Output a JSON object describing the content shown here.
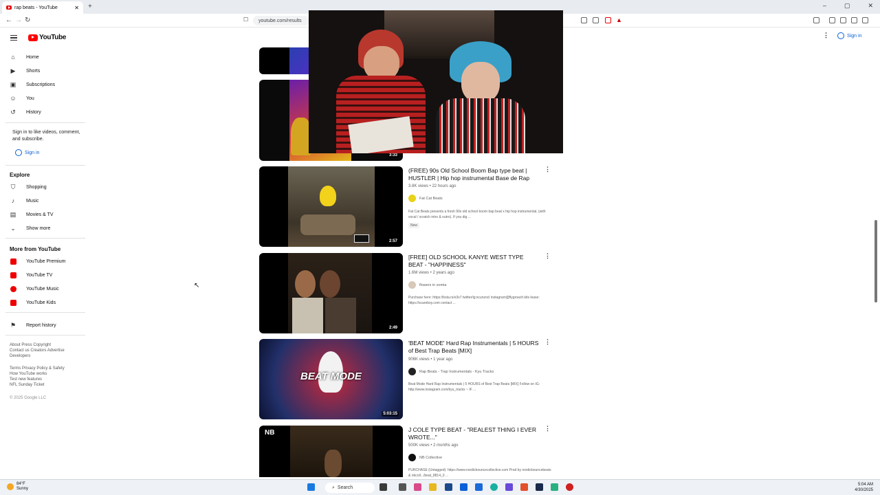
{
  "browser": {
    "tab_title": "rap beats - YouTube",
    "tab_close": "✕",
    "new_tab": "+",
    "address": "youtube.com/results",
    "win_min": "–",
    "win_max": "▢",
    "win_close": "✕"
  },
  "sidebar": {
    "logo_text": "YouTube",
    "main_items": [
      {
        "label": "Home",
        "icon": "home-icon"
      },
      {
        "label": "Shorts",
        "icon": "shorts-icon"
      },
      {
        "label": "Subscriptions",
        "icon": "subscriptions-icon"
      },
      {
        "label": "You",
        "icon": "you-icon"
      },
      {
        "label": "History",
        "icon": "history-icon"
      }
    ],
    "signin_note": "Sign in to like videos, comment, and subscribe.",
    "signin_label": "Sign in",
    "explore_title": "Explore",
    "explore_items": [
      {
        "label": "Shopping",
        "icon": "shopping-icon"
      },
      {
        "label": "Music",
        "icon": "music-icon"
      },
      {
        "label": "Movies & TV",
        "icon": "movies-icon"
      },
      {
        "label": "Show more",
        "icon": "chevron-down-icon"
      }
    ],
    "more_title": "More from YouTube",
    "more_items": [
      {
        "label": "YouTube Premium"
      },
      {
        "label": "YouTube TV"
      },
      {
        "label": "YouTube Music"
      },
      {
        "label": "YouTube Kids"
      }
    ],
    "report_history": "Report history",
    "footer1": "About  Press  Copyright\nContact us  Creators  Advertise\nDevelopers",
    "footer2": "Terms  Privacy  Policy & Safety\nHow YouTube works\nTest new features\nNFL Sunday Ticket",
    "copyright": "© 2025 Google LLC"
  },
  "header": {
    "signin_label": "Sign in"
  },
  "videos": [
    {
      "title": "",
      "duration": ""
    },
    {
      "title": "",
      "duration": "3:33"
    },
    {
      "title": "(FREE) 90s Old School Boom Bap type beat | HUSTLER | Hip hop instrumental Base de Rap",
      "meta": "3.8K views • 22 hours ago",
      "channel": "Fat Cat Beats",
      "desc": "Fat Cat Beats presents a fresh 90s old school boom bap beat x hip hop instrumental, (with vocal / scratch intro & outro). If you dig ...",
      "badge": "New",
      "duration": "2:57"
    },
    {
      "title": "[FREE] OLD SCHOOL KANYE WEST TYPE BEAT - \"HAPPINESS\"",
      "meta": "1.6M views • 2 years ago",
      "channel": "flowers in somia",
      "desc": "Purchase here: https://bsta.rs/e3x7 twitter/ig:scunzocl instagram@flygroach.kits lease: https://scareboy.com contact ...",
      "duration": "2:49"
    },
    {
      "title": "'BEAT MODE' Hard Rap Instrumentals | 5 HOURS of Best Trap Beats [MIX]",
      "meta": "906K views • 1 year ago",
      "channel": "Rap Beats - Trap Instrumentals - Kyu Tracks",
      "desc": "Beat Mode Hard Rap Instrumentals | 5 HOURS of Best Trap Beats [MIX] Follow on IG: http://www.instagram.com/kyu_tracks ~ IF ...",
      "duration": "5:03:15",
      "thumb_text": "BEAT MODE"
    },
    {
      "title": "J COLE TYPE BEAT - \"REALEST THING I EVER WROTE...\"",
      "meta": "500K views • 2 months ago",
      "channel": "NB Collective",
      "desc": "PURCHASE (Untagged): https://www.nordicbouncecollective.com Prod by nordicbouncebeats & nbcoll.../beat_8814_0 ...",
      "thumb_text": "NB"
    }
  ],
  "taskbar": {
    "weather_temp": "84°F",
    "weather_desc": "Sunny",
    "search": "Search",
    "time": "5:04 AM",
    "date": "4/30/2025"
  },
  "colors": {
    "accent_red": "#ff0000",
    "link_blue": "#065fd4"
  }
}
